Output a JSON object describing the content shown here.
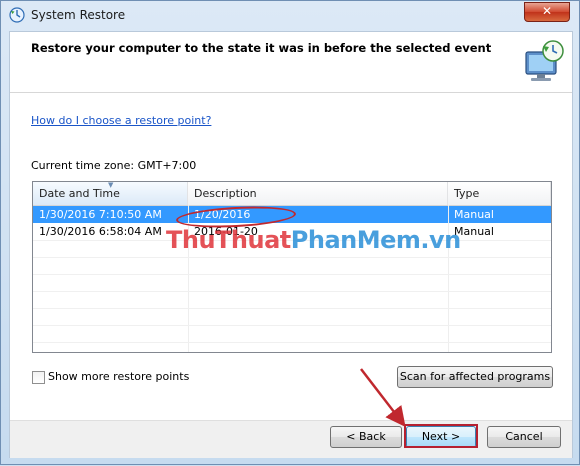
{
  "window": {
    "title": "System Restore",
    "close_glyph": "✕"
  },
  "header": {
    "title": "Restore your computer to the state it was in before the selected event"
  },
  "body": {
    "help_link": "How do I choose a restore point?",
    "timezone": "Current time zone: GMT+7:00",
    "columns": [
      "Date and Time",
      "Description",
      "Type"
    ],
    "rows": [
      {
        "date": "1/30/2016 7:10:50 AM",
        "description": "1/20/2016",
        "type": "Manual"
      },
      {
        "date": "1/30/2016 6:58:04 AM",
        "description": "2016-01-20",
        "type": "Manual"
      }
    ],
    "show_more_label": "Show more restore points",
    "scan_button": "Scan for affected programs"
  },
  "footer": {
    "back": "< Back",
    "next": "Next >",
    "cancel": "Cancel"
  },
  "watermark": {
    "part1": "Thu",
    "part2": "Thuat",
    "part3": "PhanMem",
    "part4": ".vn"
  },
  "colors": {
    "selection": "#3399ff",
    "annotation_red": "#c0282e",
    "link": "#1a55c8"
  }
}
